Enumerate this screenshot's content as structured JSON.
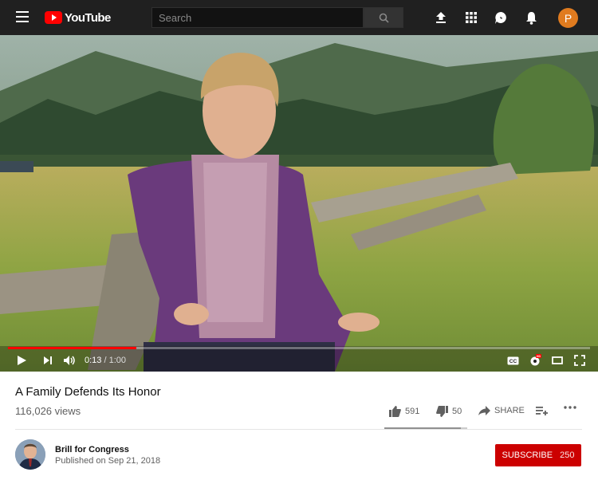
{
  "header": {
    "logo_text": "YouTube",
    "search_placeholder": "Search",
    "avatar_letter": "P",
    "avatar_color": "#e07b1f"
  },
  "player": {
    "current_time": "0:13",
    "separator": "/",
    "duration": "1:00",
    "progress": 0.22,
    "controls": [
      "play-icon",
      "next-icon",
      "volume-icon",
      "captions-icon",
      "settings-icon",
      "theater-icon",
      "fullscreen-icon"
    ]
  },
  "video": {
    "title": "A Family Defends Its Honor",
    "views": "116,026 views",
    "likes": "591",
    "dislikes": "50",
    "share_label": "SHARE",
    "like_ratio": 0.92
  },
  "channel": {
    "name": "Brill for Congress",
    "published": "Published on Sep 21, 2018",
    "subscribe_label": "SUBSCRIBE",
    "subscriber_count": "250"
  },
  "colors": {
    "accent": "#ff0000",
    "subscribe": "#cc0000",
    "topbar": "#202020"
  }
}
